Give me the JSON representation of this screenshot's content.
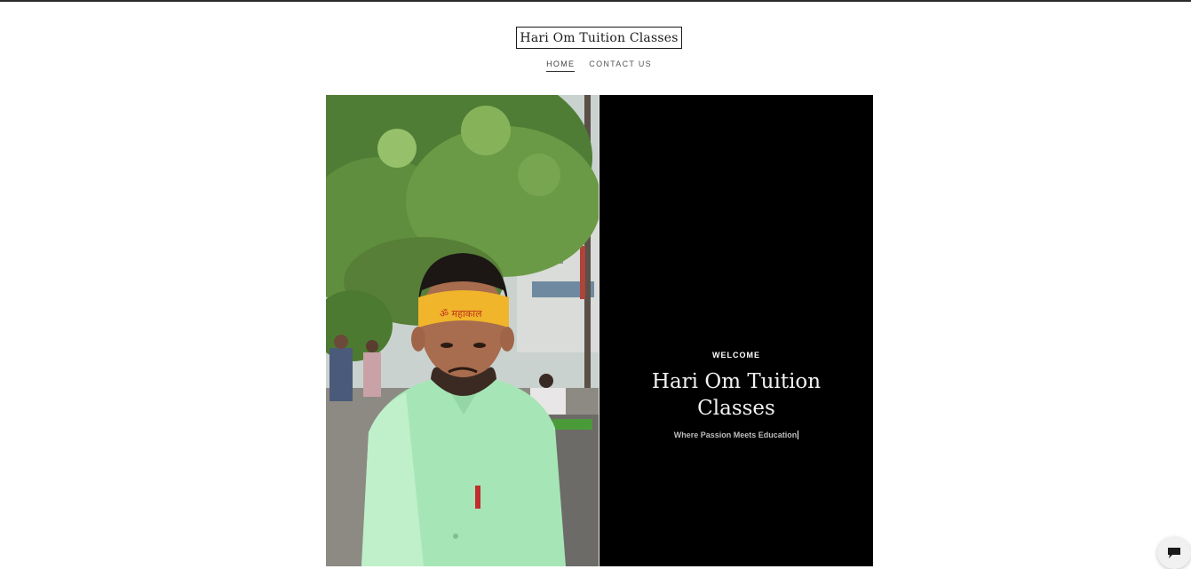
{
  "header": {
    "logo_text": "Hari Om Tuition Classes"
  },
  "nav": {
    "items": [
      {
        "label": "HOME",
        "active": true
      },
      {
        "label": "CONTACT US",
        "active": false
      }
    ]
  },
  "hero": {
    "eyebrow": "WELCOME",
    "title": "Hari Om Tuition Classes",
    "tagline": "Where Passion Meets Education",
    "panel_color": "#000000"
  },
  "chat": {
    "icon": "chat-bubble-icon"
  }
}
